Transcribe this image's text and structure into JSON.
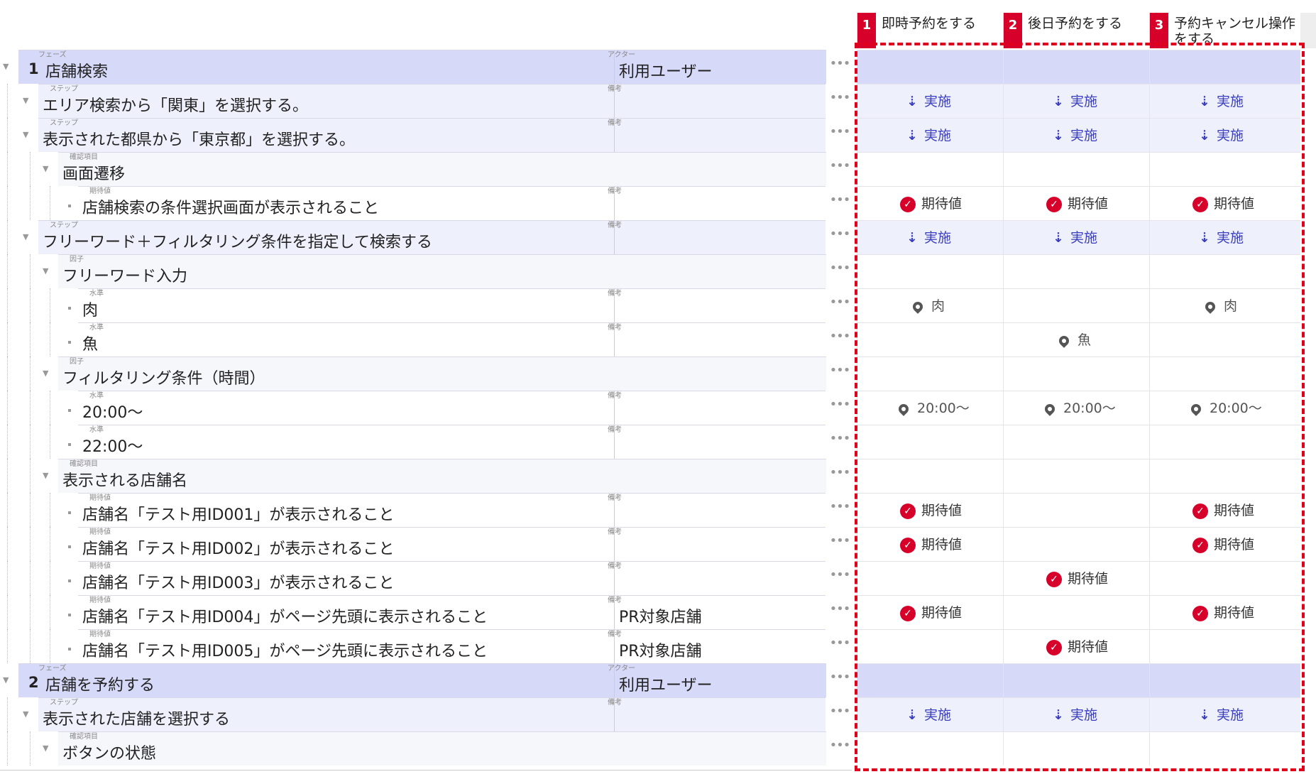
{
  "cases": [
    {
      "number": "1",
      "label": "即時予約をする"
    },
    {
      "number": "2",
      "label": "後日予約をする"
    },
    {
      "number": "3",
      "label": "予約キャンセル操作をする"
    }
  ],
  "labels": {
    "phase": "フェーズ",
    "actor": "アクター",
    "step": "ステップ",
    "check": "確認項目",
    "expected": "期待値",
    "factor": "因子",
    "level": "水準",
    "note": "備考",
    "more": "•••",
    "exec": "実施",
    "expected_mark": "期待値"
  },
  "rows": [
    {
      "type": "phase",
      "num": "1",
      "text": "店舗検索",
      "side": "利用ユーザー",
      "marks": [
        null,
        null,
        null
      ]
    },
    {
      "type": "step",
      "text": "エリア検索から「関東」を選択する。",
      "side": "",
      "marks": [
        {
          "k": "exec"
        },
        {
          "k": "exec"
        },
        {
          "k": "exec"
        }
      ]
    },
    {
      "type": "step",
      "text": "表示された都県から「東京都」を選択する。",
      "side": "",
      "marks": [
        {
          "k": "exec"
        },
        {
          "k": "exec"
        },
        {
          "k": "exec"
        }
      ]
    },
    {
      "type": "check",
      "text": "画面遷移",
      "marks": [
        null,
        null,
        null
      ]
    },
    {
      "type": "expected",
      "text": "店舗検索の条件選択画面が表示されること",
      "side": "",
      "marks": [
        {
          "k": "exp"
        },
        {
          "k": "exp"
        },
        {
          "k": "exp"
        }
      ]
    },
    {
      "type": "step",
      "text": "フリーワード＋フィルタリング条件を指定して検索する",
      "side": "",
      "marks": [
        {
          "k": "exec"
        },
        {
          "k": "exec"
        },
        {
          "k": "exec"
        }
      ]
    },
    {
      "type": "factor",
      "text": "フリーワード入力",
      "marks": [
        null,
        null,
        null
      ]
    },
    {
      "type": "level",
      "text": "肉",
      "side": "",
      "marks": [
        {
          "k": "lvl",
          "v": "肉"
        },
        null,
        {
          "k": "lvl",
          "v": "肉"
        }
      ]
    },
    {
      "type": "level",
      "text": "魚",
      "side": "",
      "marks": [
        null,
        {
          "k": "lvl",
          "v": "魚"
        },
        null
      ]
    },
    {
      "type": "factor",
      "text": "フィルタリング条件（時間）",
      "marks": [
        null,
        null,
        null
      ]
    },
    {
      "type": "level",
      "text": "20:00～",
      "side": "",
      "marks": [
        {
          "k": "lvl",
          "v": "20:00～"
        },
        {
          "k": "lvl",
          "v": "20:00～"
        },
        {
          "k": "lvl",
          "v": "20:00～"
        }
      ]
    },
    {
      "type": "level",
      "text": "22:00～",
      "side": "",
      "marks": [
        null,
        null,
        null
      ]
    },
    {
      "type": "check",
      "text": "表示される店舗名",
      "marks": [
        null,
        null,
        null
      ]
    },
    {
      "type": "expected",
      "text": "店舗名「テスト用ID001」が表示されること",
      "side": "",
      "marks": [
        {
          "k": "exp"
        },
        null,
        {
          "k": "exp"
        }
      ]
    },
    {
      "type": "expected",
      "text": "店舗名「テスト用ID002」が表示されること",
      "side": "",
      "marks": [
        {
          "k": "exp"
        },
        null,
        {
          "k": "exp"
        }
      ]
    },
    {
      "type": "expected",
      "text": "店舗名「テスト用ID003」が表示されること",
      "side": "",
      "marks": [
        null,
        {
          "k": "exp"
        },
        null
      ]
    },
    {
      "type": "expected",
      "text": "店舗名「テスト用ID004」がページ先頭に表示されること",
      "side": "PR対象店舗",
      "marks": [
        {
          "k": "exp"
        },
        null,
        {
          "k": "exp"
        }
      ]
    },
    {
      "type": "expected",
      "text": "店舗名「テスト用ID005」がページ先頭に表示されること",
      "side": "PR対象店舗",
      "marks": [
        null,
        {
          "k": "exp"
        },
        null
      ]
    },
    {
      "type": "phase",
      "num": "2",
      "text": "店舗を予約する",
      "side": "利用ユーザー",
      "marks": [
        null,
        null,
        null
      ]
    },
    {
      "type": "step",
      "text": "表示された店舗を選択する",
      "side": "",
      "marks": [
        {
          "k": "exec"
        },
        {
          "k": "exec"
        },
        {
          "k": "exec"
        }
      ]
    },
    {
      "type": "check",
      "text": "ボタンの状態",
      "marks": [
        null,
        null,
        null
      ]
    }
  ],
  "colors": {
    "accent": "#d6002a",
    "phase_bg": "#d7d9f8",
    "step_bg": "#eef0fc",
    "exec": "#3b3fbf",
    "frame": "#e0001b"
  },
  "icons": {
    "exec": "arrow-down-icon",
    "expected": "check-circle-icon",
    "level": "map-pin-icon",
    "toggle": "chevron-down-icon"
  }
}
